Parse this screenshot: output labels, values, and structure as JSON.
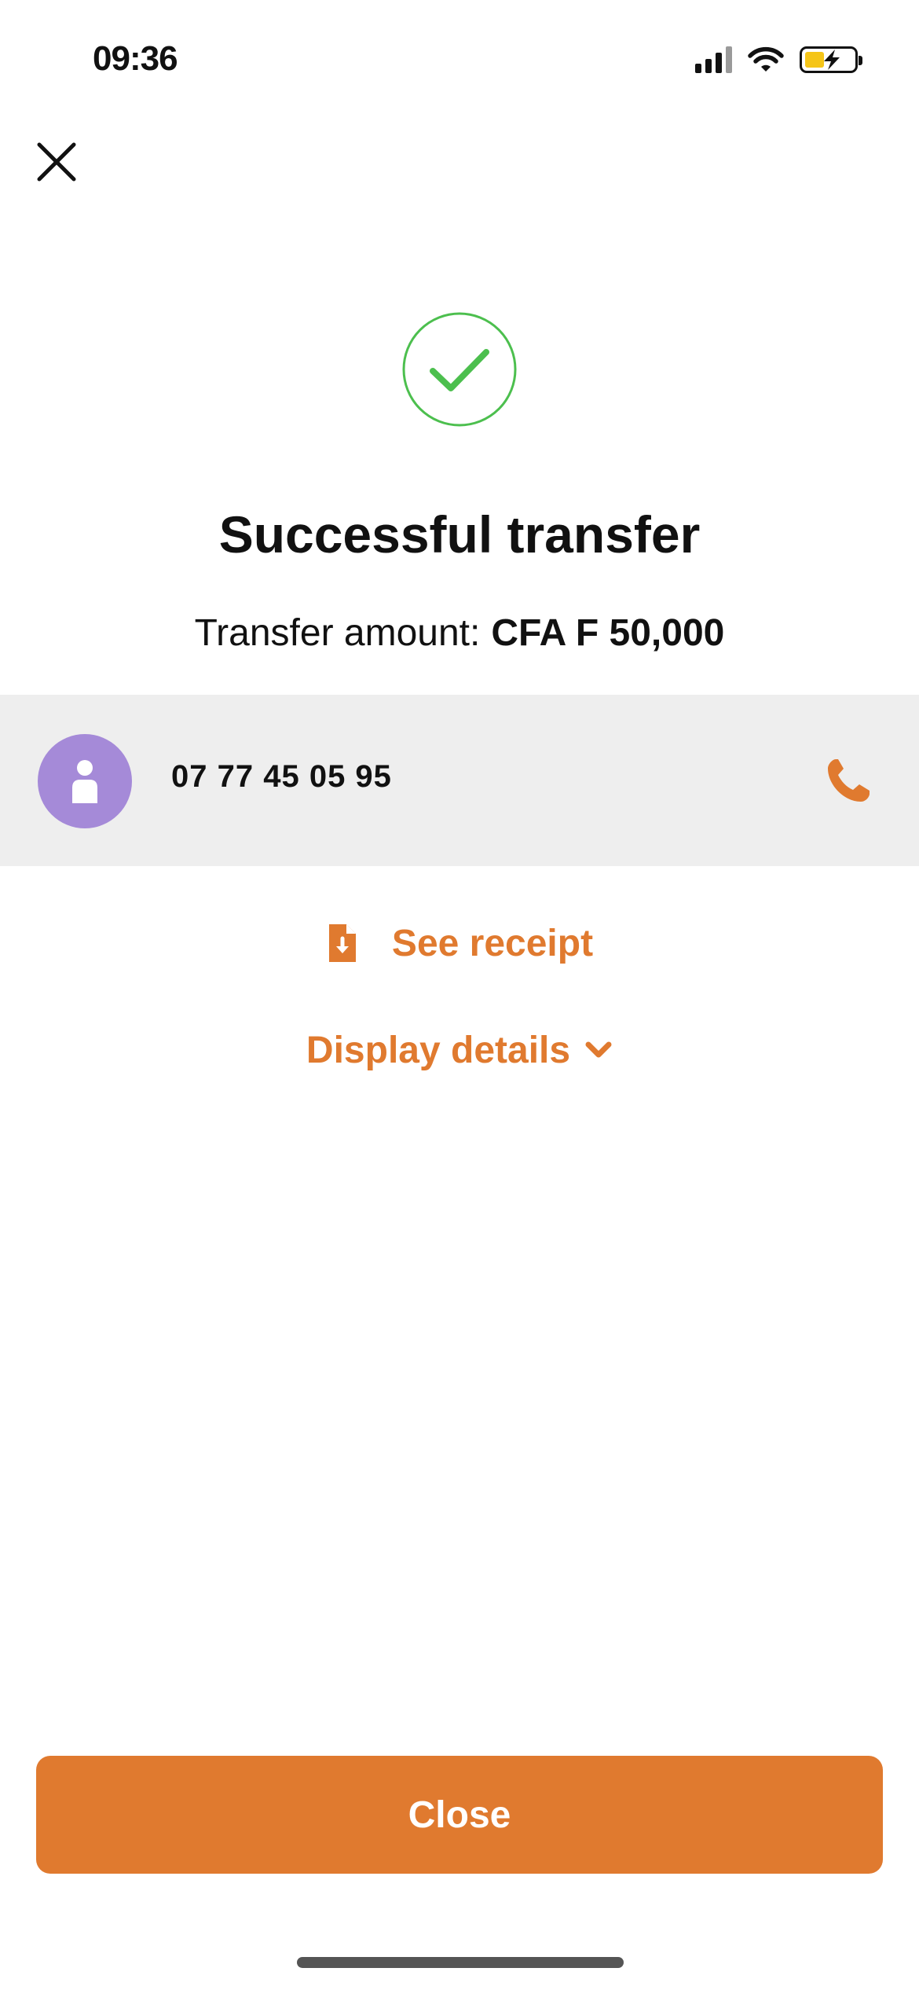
{
  "status_bar": {
    "time": "09:36"
  },
  "icons": {
    "close": "close-icon",
    "success": "checkmark-circle-icon",
    "avatar": "person-icon",
    "call": "phone-icon",
    "receipt": "document-download-icon",
    "expand": "chevron-down-icon"
  },
  "colors": {
    "accent": "#e07a2f",
    "success": "#4cbf4e",
    "avatar": "#a58ad8",
    "row_background": "#eeeeee"
  },
  "main": {
    "title": "Successful transfer",
    "amount_label": "Transfer amount:",
    "amount_value": "CFA F 50,000"
  },
  "recipient": {
    "phone_number": "07 77 45 05 95"
  },
  "actions": {
    "see_receipt": "See receipt",
    "display_details": "Display details"
  },
  "footer": {
    "close_label": "Close"
  }
}
